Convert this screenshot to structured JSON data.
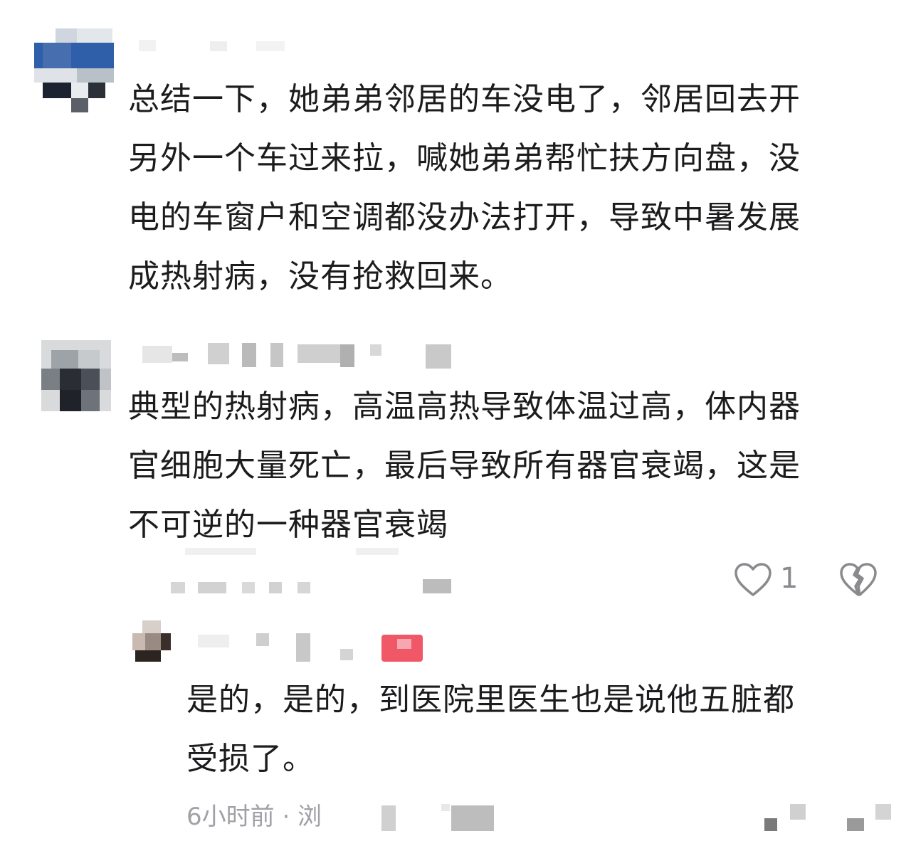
{
  "comments": [
    {
      "text_lines": [
        "总结一下，她弟弟邻居的车没电了，邻居回去开",
        "另外一个车过来拉，喊她弟弟帮忙扶方向盘，没",
        "电的车窗户和空调都没办法打开，导致中暑发展",
        "成热射病，没有抢救回来。"
      ]
    },
    {
      "text_lines": [
        "典型的热射病，高温高热导致体温过高，体内器",
        "官细胞大量死亡，最后导致所有器官衰竭，这是",
        "不可逆的一种器官衰竭"
      ],
      "like_count": "1"
    }
  ],
  "reply": {
    "text_lines": [
      "是的，是的，到医院里医生也是说他五脏都",
      "受损了。"
    ],
    "time": "6小时前 · 浏"
  },
  "icons": {
    "like": "heart-outline-icon",
    "dislike": "broken-heart-icon"
  },
  "colors": {
    "text": "#1c1c1e",
    "meta": "#a0a0a6",
    "icon": "#8a8a8e",
    "badge": "#f04a5a"
  }
}
